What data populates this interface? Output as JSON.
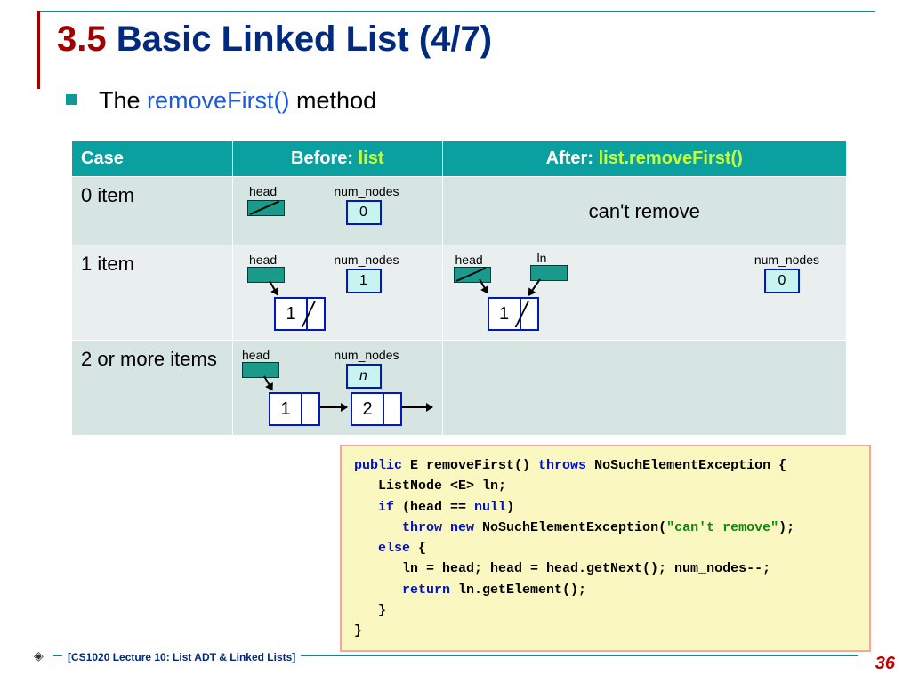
{
  "title": {
    "section": "3.5",
    "rest": "Basic Linked List (4/7)"
  },
  "bullet": {
    "pre": "The ",
    "code": "removeFirst()",
    "post": " method"
  },
  "table": {
    "headers": {
      "case": "Case",
      "before_pre": "Before: ",
      "before_hl": "list",
      "after_pre": "After: ",
      "after_hl": "list.removeFirst()"
    },
    "rows": {
      "r0": {
        "label": "0 item",
        "head": "head",
        "nn": "num_nodes",
        "nn_val": "0",
        "after": "can't remove"
      },
      "r1": {
        "label": "1 item",
        "head": "head",
        "nn": "num_nodes",
        "nn_val": "1",
        "node1": "1",
        "after_head": "head",
        "after_ln": "ln",
        "after_nn": "num_nodes",
        "after_nn_val": "0",
        "after_node1": "1"
      },
      "r2": {
        "label": "2 or more items",
        "head": "head",
        "nn": "num_nodes",
        "nn_val": "n",
        "node1": "1",
        "node2": "2"
      }
    }
  },
  "code": {
    "l1a": "public",
    "l1b": " E removeFirst() ",
    "l1c": "throws",
    "l1d": " NoSuchElementException {",
    "l2": "   ListNode <E> ln;",
    "l3a": "   ",
    "l3b": "if",
    "l3c": " (head == ",
    "l3d": "null",
    "l3e": ")",
    "l4a": "      ",
    "l4b": "throw new",
    "l4c": " NoSuchElementException(",
    "l4d": "\"can't remove\"",
    "l4e": ");",
    "l5a": "   ",
    "l5b": "else",
    "l5c": " {",
    "l6": "      ln = head; head = head.getNext(); num_nodes--;",
    "l7a": "      ",
    "l7b": "return",
    "l7c": " ln.getElement();",
    "l8": "   }",
    "l9": "}"
  },
  "footer": {
    "text": "[CS1020 Lecture 10: List ADT & Linked Lists]",
    "page": "36"
  }
}
